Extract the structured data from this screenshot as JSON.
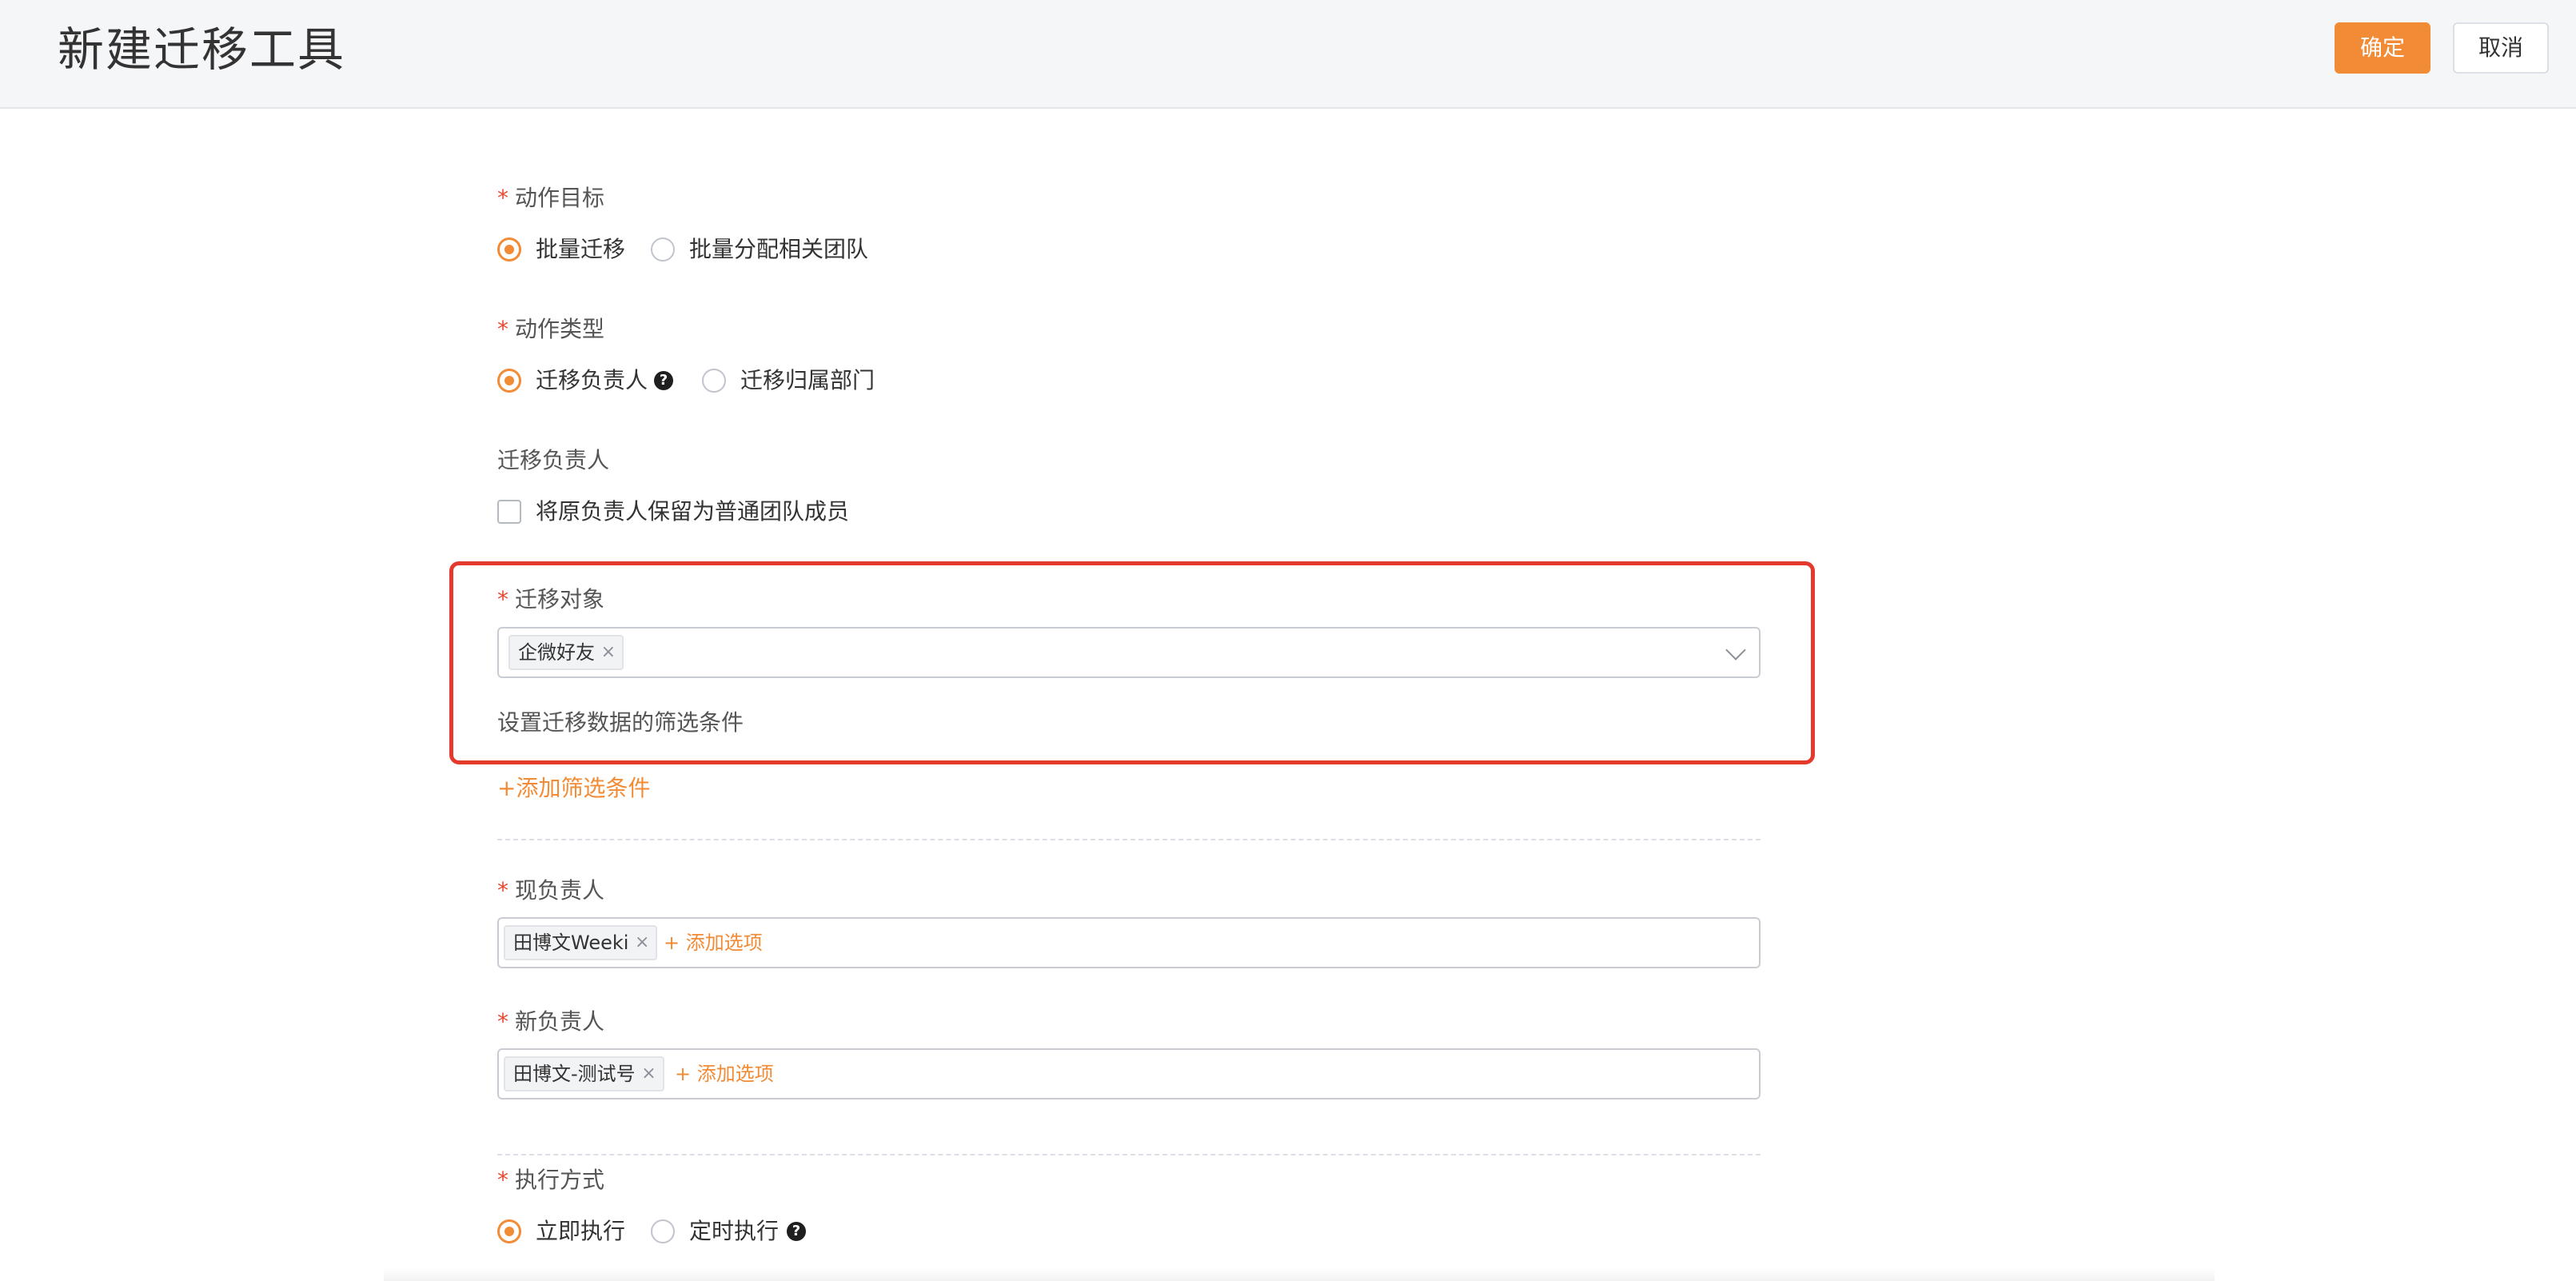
{
  "header": {
    "title": "新建迁移工具",
    "confirm_label": "确定",
    "cancel_label": "取消"
  },
  "form": {
    "action_target": {
      "label": "动作目标",
      "required_mark": "*",
      "options": [
        "批量迁移",
        "批量分配相关团队"
      ],
      "selected": "批量迁移"
    },
    "action_type": {
      "label": "动作类型",
      "required_mark": "*",
      "options": [
        "迁移负责人",
        "迁移归属部门"
      ],
      "selected": "迁移负责人"
    },
    "migrate_owner": {
      "label": "迁移负责人",
      "checkbox_label": "将原负责人保留为普通团队成员",
      "checked": false
    },
    "migrate_object": {
      "label": "迁移对象",
      "required_mark": "*",
      "tags": [
        "企微好友"
      ],
      "filter_hint": "设置迁移数据的筛选条件",
      "add_filter_label": "+添加筛选条件"
    },
    "current_owner": {
      "label": "现负责人",
      "required_mark": "*",
      "tags": [
        "田博文Weeki"
      ],
      "add_option_label": "+ 添加选项"
    },
    "new_owner": {
      "label": "新负责人",
      "required_mark": "*",
      "tags": [
        "田博文-测试号"
      ],
      "add_option_label": "+ 添加选项"
    },
    "execution_mode": {
      "label": "执行方式",
      "required_mark": "*",
      "options": [
        "立即执行",
        "定时执行"
      ],
      "selected": "立即执行"
    }
  },
  "icons": {
    "help": "question-circle-icon",
    "tag_close": "close-icon",
    "dropdown": "chevron-down-icon"
  },
  "colors": {
    "accent": "#f28b35",
    "required": "#e8492f",
    "highlight_border": "#e43a2b"
  }
}
